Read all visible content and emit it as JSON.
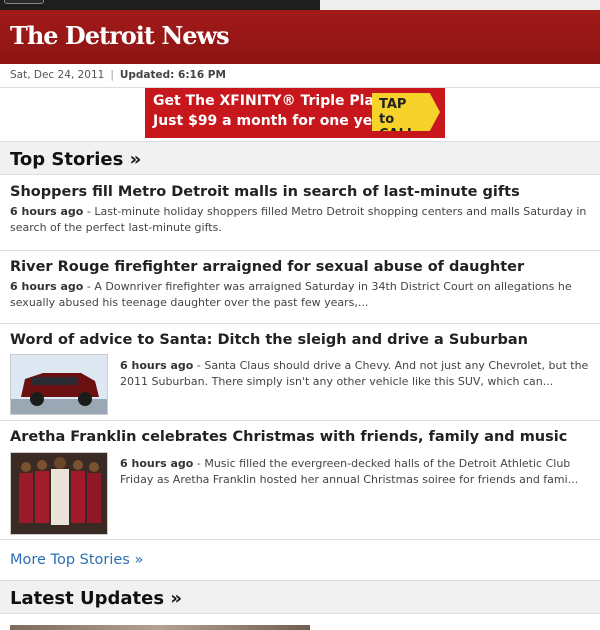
{
  "masthead": {
    "title": "The Detroit News"
  },
  "datebar": {
    "date": "Sat, Dec 24, 2011",
    "separator": "|",
    "updated": "Updated: 6:16 PM"
  },
  "ad": {
    "line1": "Get The XFINITY® Triple Play.",
    "line2": "Just $99 a month for one year.",
    "cta_line1": "TAP",
    "cta_line2": "to CALL"
  },
  "sections": {
    "top_stories": "Top Stories »",
    "more_top_stories": "More Top Stories »",
    "latest_updates": "Latest Updates »"
  },
  "stories": [
    {
      "headline": "Shoppers fill Metro Detroit malls in search of last-minute gifts",
      "time": "6 hours ago",
      "summary": "Last-minute holiday shoppers filled Metro Detroit shopping centers and malls Saturday in search of the perfect last-minute gifts."
    },
    {
      "headline": "River Rouge firefighter arraigned for sexual abuse of daughter",
      "time": "6 hours ago",
      "summary": "A Downriver firefighter was arraigned Saturday in 34th District Court on allegations he sexually abused his teenage daughter over the past few years,..."
    },
    {
      "headline": "Word of advice to Santa: Ditch the sleigh and drive a Suburban",
      "time": "6 hours ago",
      "summary": "Santa Claus should drive a Chevy. And not just any Chevrolet, but the 2011 Suburban. There simply isn't any other vehicle like this SUV, which can..."
    },
    {
      "headline": "Aretha Franklin celebrates Christmas with friends, family and music",
      "time": "6 hours ago",
      "summary": "Music filled the evergreen-decked halls of the Detroit Athletic Club Friday as Aretha Franklin hosted her annual Christmas soiree for friends and fami..."
    }
  ],
  "dash": "-"
}
